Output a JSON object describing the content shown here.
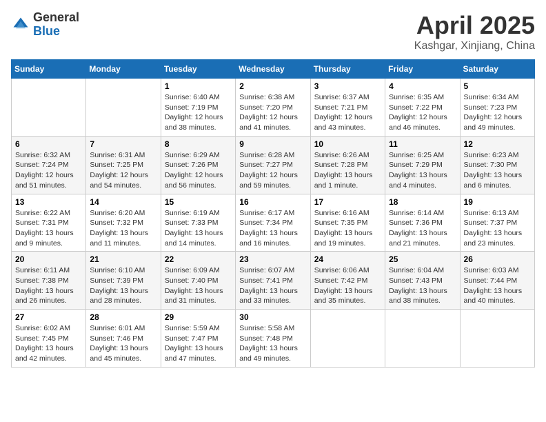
{
  "header": {
    "logo_general": "General",
    "logo_blue": "Blue",
    "title": "April 2025",
    "location": "Kashgar, Xinjiang, China"
  },
  "days_of_week": [
    "Sunday",
    "Monday",
    "Tuesday",
    "Wednesday",
    "Thursday",
    "Friday",
    "Saturday"
  ],
  "weeks": [
    [
      {
        "day": "",
        "sunrise": "",
        "sunset": "",
        "daylight": ""
      },
      {
        "day": "",
        "sunrise": "",
        "sunset": "",
        "daylight": ""
      },
      {
        "day": "1",
        "sunrise": "Sunrise: 6:40 AM",
        "sunset": "Sunset: 7:19 PM",
        "daylight": "Daylight: 12 hours and 38 minutes."
      },
      {
        "day": "2",
        "sunrise": "Sunrise: 6:38 AM",
        "sunset": "Sunset: 7:20 PM",
        "daylight": "Daylight: 12 hours and 41 minutes."
      },
      {
        "day": "3",
        "sunrise": "Sunrise: 6:37 AM",
        "sunset": "Sunset: 7:21 PM",
        "daylight": "Daylight: 12 hours and 43 minutes."
      },
      {
        "day": "4",
        "sunrise": "Sunrise: 6:35 AM",
        "sunset": "Sunset: 7:22 PM",
        "daylight": "Daylight: 12 hours and 46 minutes."
      },
      {
        "day": "5",
        "sunrise": "Sunrise: 6:34 AM",
        "sunset": "Sunset: 7:23 PM",
        "daylight": "Daylight: 12 hours and 49 minutes."
      }
    ],
    [
      {
        "day": "6",
        "sunrise": "Sunrise: 6:32 AM",
        "sunset": "Sunset: 7:24 PM",
        "daylight": "Daylight: 12 hours and 51 minutes."
      },
      {
        "day": "7",
        "sunrise": "Sunrise: 6:31 AM",
        "sunset": "Sunset: 7:25 PM",
        "daylight": "Daylight: 12 hours and 54 minutes."
      },
      {
        "day": "8",
        "sunrise": "Sunrise: 6:29 AM",
        "sunset": "Sunset: 7:26 PM",
        "daylight": "Daylight: 12 hours and 56 minutes."
      },
      {
        "day": "9",
        "sunrise": "Sunrise: 6:28 AM",
        "sunset": "Sunset: 7:27 PM",
        "daylight": "Daylight: 12 hours and 59 minutes."
      },
      {
        "day": "10",
        "sunrise": "Sunrise: 6:26 AM",
        "sunset": "Sunset: 7:28 PM",
        "daylight": "Daylight: 13 hours and 1 minute."
      },
      {
        "day": "11",
        "sunrise": "Sunrise: 6:25 AM",
        "sunset": "Sunset: 7:29 PM",
        "daylight": "Daylight: 13 hours and 4 minutes."
      },
      {
        "day": "12",
        "sunrise": "Sunrise: 6:23 AM",
        "sunset": "Sunset: 7:30 PM",
        "daylight": "Daylight: 13 hours and 6 minutes."
      }
    ],
    [
      {
        "day": "13",
        "sunrise": "Sunrise: 6:22 AM",
        "sunset": "Sunset: 7:31 PM",
        "daylight": "Daylight: 13 hours and 9 minutes."
      },
      {
        "day": "14",
        "sunrise": "Sunrise: 6:20 AM",
        "sunset": "Sunset: 7:32 PM",
        "daylight": "Daylight: 13 hours and 11 minutes."
      },
      {
        "day": "15",
        "sunrise": "Sunrise: 6:19 AM",
        "sunset": "Sunset: 7:33 PM",
        "daylight": "Daylight: 13 hours and 14 minutes."
      },
      {
        "day": "16",
        "sunrise": "Sunrise: 6:17 AM",
        "sunset": "Sunset: 7:34 PM",
        "daylight": "Daylight: 13 hours and 16 minutes."
      },
      {
        "day": "17",
        "sunrise": "Sunrise: 6:16 AM",
        "sunset": "Sunset: 7:35 PM",
        "daylight": "Daylight: 13 hours and 19 minutes."
      },
      {
        "day": "18",
        "sunrise": "Sunrise: 6:14 AM",
        "sunset": "Sunset: 7:36 PM",
        "daylight": "Daylight: 13 hours and 21 minutes."
      },
      {
        "day": "19",
        "sunrise": "Sunrise: 6:13 AM",
        "sunset": "Sunset: 7:37 PM",
        "daylight": "Daylight: 13 hours and 23 minutes."
      }
    ],
    [
      {
        "day": "20",
        "sunrise": "Sunrise: 6:11 AM",
        "sunset": "Sunset: 7:38 PM",
        "daylight": "Daylight: 13 hours and 26 minutes."
      },
      {
        "day": "21",
        "sunrise": "Sunrise: 6:10 AM",
        "sunset": "Sunset: 7:39 PM",
        "daylight": "Daylight: 13 hours and 28 minutes."
      },
      {
        "day": "22",
        "sunrise": "Sunrise: 6:09 AM",
        "sunset": "Sunset: 7:40 PM",
        "daylight": "Daylight: 13 hours and 31 minutes."
      },
      {
        "day": "23",
        "sunrise": "Sunrise: 6:07 AM",
        "sunset": "Sunset: 7:41 PM",
        "daylight": "Daylight: 13 hours and 33 minutes."
      },
      {
        "day": "24",
        "sunrise": "Sunrise: 6:06 AM",
        "sunset": "Sunset: 7:42 PM",
        "daylight": "Daylight: 13 hours and 35 minutes."
      },
      {
        "day": "25",
        "sunrise": "Sunrise: 6:04 AM",
        "sunset": "Sunset: 7:43 PM",
        "daylight": "Daylight: 13 hours and 38 minutes."
      },
      {
        "day": "26",
        "sunrise": "Sunrise: 6:03 AM",
        "sunset": "Sunset: 7:44 PM",
        "daylight": "Daylight: 13 hours and 40 minutes."
      }
    ],
    [
      {
        "day": "27",
        "sunrise": "Sunrise: 6:02 AM",
        "sunset": "Sunset: 7:45 PM",
        "daylight": "Daylight: 13 hours and 42 minutes."
      },
      {
        "day": "28",
        "sunrise": "Sunrise: 6:01 AM",
        "sunset": "Sunset: 7:46 PM",
        "daylight": "Daylight: 13 hours and 45 minutes."
      },
      {
        "day": "29",
        "sunrise": "Sunrise: 5:59 AM",
        "sunset": "Sunset: 7:47 PM",
        "daylight": "Daylight: 13 hours and 47 minutes."
      },
      {
        "day": "30",
        "sunrise": "Sunrise: 5:58 AM",
        "sunset": "Sunset: 7:48 PM",
        "daylight": "Daylight: 13 hours and 49 minutes."
      },
      {
        "day": "",
        "sunrise": "",
        "sunset": "",
        "daylight": ""
      },
      {
        "day": "",
        "sunrise": "",
        "sunset": "",
        "daylight": ""
      },
      {
        "day": "",
        "sunrise": "",
        "sunset": "",
        "daylight": ""
      }
    ]
  ]
}
